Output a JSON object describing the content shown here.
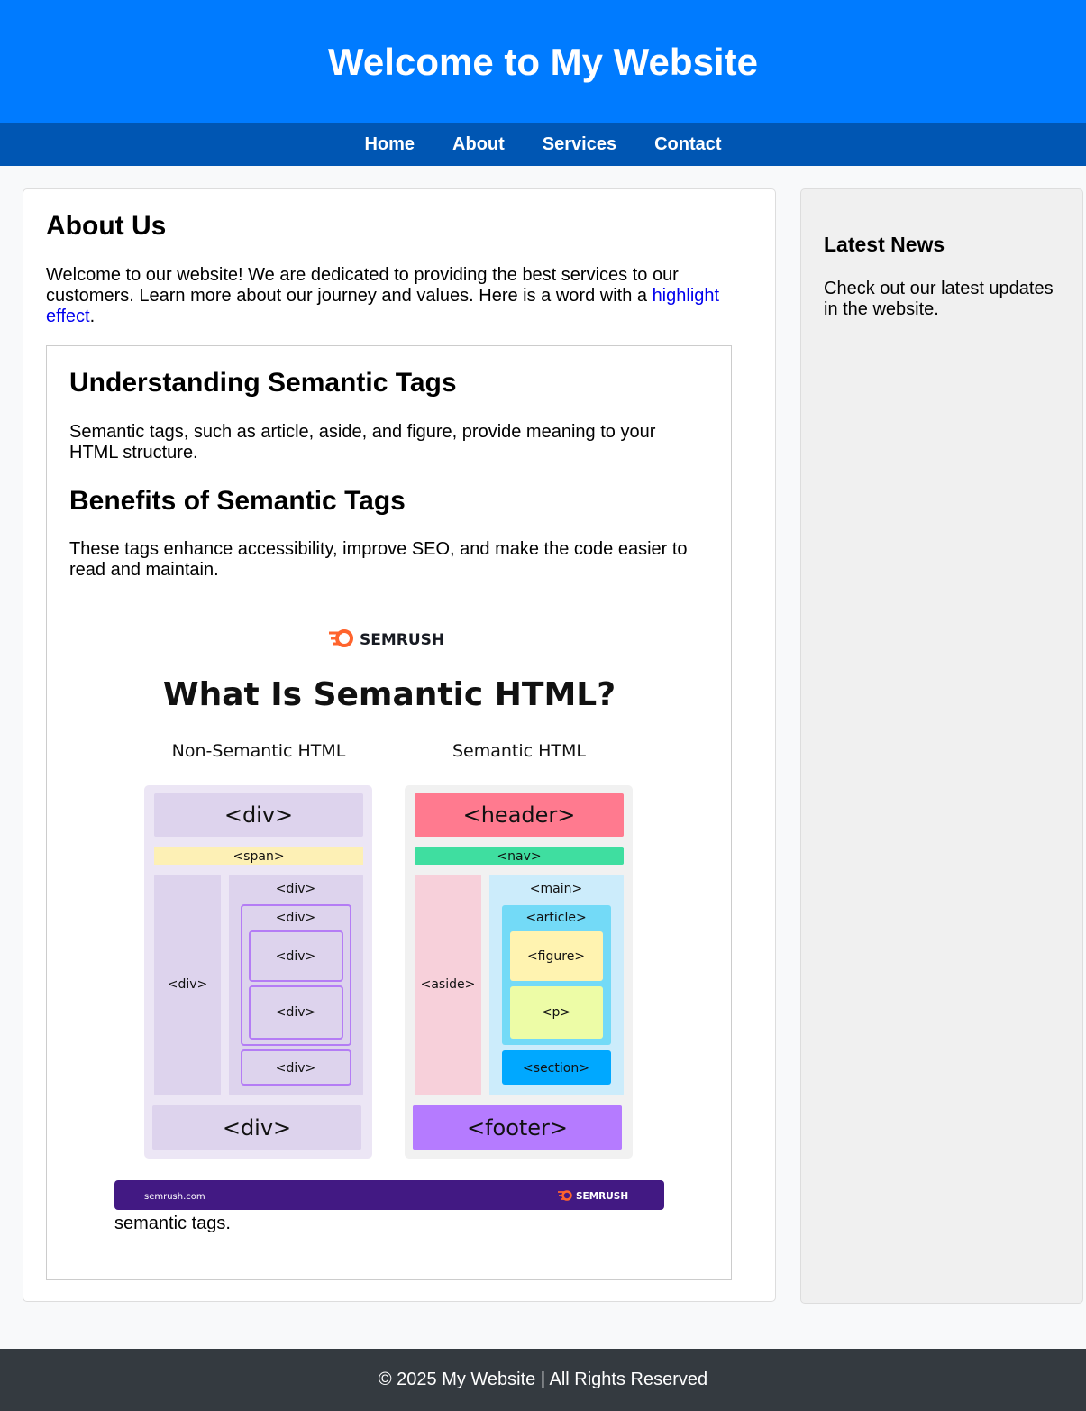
{
  "header": {
    "title": "Welcome to My Website"
  },
  "nav": {
    "items": [
      {
        "label": "Home"
      },
      {
        "label": "About"
      },
      {
        "label": "Services"
      },
      {
        "label": "Contact"
      }
    ]
  },
  "main": {
    "title": "About Us",
    "intro_text": "Welcome to our website! We are dedicated to providing the best services to our customers. Learn more about our journey and values. Here is a word with a ",
    "highlight_link": "highlight effect",
    "intro_end": ".",
    "article": {
      "heading1": "Understanding Semantic Tags",
      "para1": "Semantic tags, such as article, aside, and figure, provide meaning to your HTML structure.",
      "heading2": "Benefits of Semantic Tags",
      "para2": "These tags enhance accessibility, improve SEO, and make the code easier to read and maintain.",
      "figure": {
        "brand": "SEMRUSH",
        "title": "What Is Semantic HTML?",
        "left_heading": "Non-Semantic HTML",
        "right_heading": "Semantic HTML",
        "tags": {
          "div": "<div>",
          "span": "<span>",
          "header": "<header>",
          "nav": "<nav>",
          "main": "<main>",
          "article": "<article>",
          "figure": "<figure>",
          "p": "<p>",
          "section": "<section>",
          "aside": "<aside>",
          "footer": "<footer>"
        },
        "footer_url": "semrush.com",
        "footer_brand": "SEMRUSH",
        "caption": "semantic tags."
      }
    }
  },
  "sidebar": {
    "title": "Latest News",
    "text": "Check out our latest updates in the website."
  },
  "footer": {
    "text": "© 2025 My Website | All Rights Reserved"
  },
  "colors": {
    "header_bg": "#007bff",
    "nav_bg": "#0056b3",
    "footer_bg": "#343a40",
    "sem_header": "#ff7a8f",
    "sem_nav": "#3fdea0",
    "sem_main": "#ccecfb",
    "sem_article": "#73daf7",
    "sem_figure": "#fff3b0",
    "sem_p": "#edfca6",
    "sem_section": "#00a8ff",
    "sem_aside": "#f7d0da",
    "sem_footer": "#b57bff",
    "nonsem_fill": "#ddd3ed",
    "banner": "#421983",
    "brand_orange": "#ff642d"
  }
}
